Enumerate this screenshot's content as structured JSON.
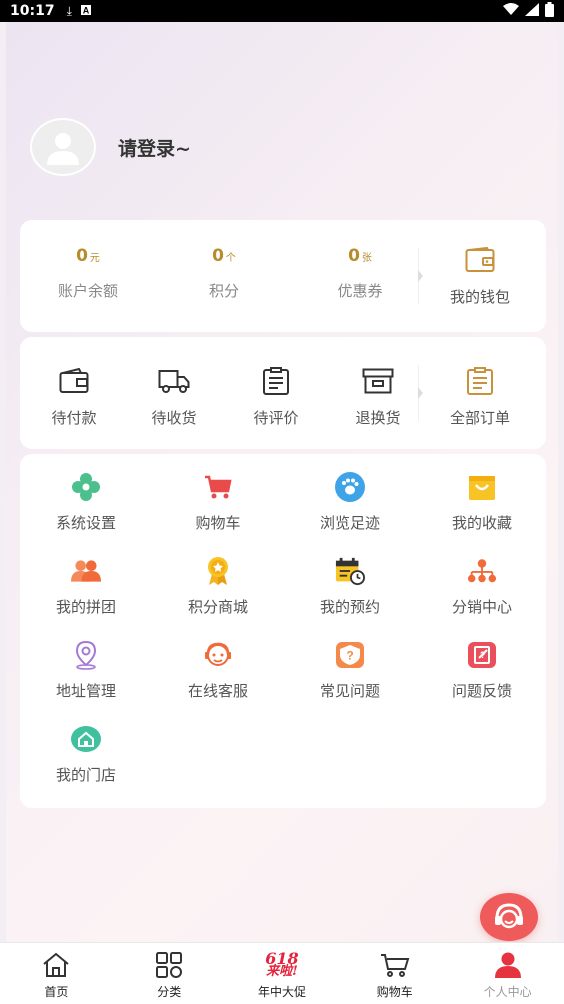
{
  "status_bar": {
    "time": "10:17"
  },
  "profile": {
    "login_text": "请登录~"
  },
  "stats": [
    {
      "value": "0",
      "unit": "元",
      "label": "账户余额"
    },
    {
      "value": "0",
      "unit": "个",
      "label": "积分"
    },
    {
      "value": "0",
      "unit": "张",
      "label": "优惠券"
    }
  ],
  "wallet": {
    "label": "我的钱包",
    "icon": "wallet-icon"
  },
  "orders": [
    {
      "label": "待付款",
      "icon": "wallet-outline-icon"
    },
    {
      "label": "待收货",
      "icon": "truck-icon"
    },
    {
      "label": "待评价",
      "icon": "clipboard-icon"
    },
    {
      "label": "退换货",
      "icon": "archive-box-icon"
    }
  ],
  "all_orders": {
    "label": "全部订单",
    "icon": "order-list-icon"
  },
  "menu": [
    {
      "label": "系统设置",
      "icon": "flower-settings-icon"
    },
    {
      "label": "购物车",
      "icon": "cart-icon"
    },
    {
      "label": "浏览足迹",
      "icon": "footprint-icon"
    },
    {
      "label": "我的收藏",
      "icon": "favorite-bag-icon"
    },
    {
      "label": "我的拼团",
      "icon": "group-icon"
    },
    {
      "label": "积分商城",
      "icon": "medal-icon"
    },
    {
      "label": "我的预约",
      "icon": "calendar-clock-icon"
    },
    {
      "label": "分销中心",
      "icon": "network-icon"
    },
    {
      "label": "地址管理",
      "icon": "location-pin-icon"
    },
    {
      "label": "在线客服",
      "icon": "customer-service-icon"
    },
    {
      "label": "常见问题",
      "icon": "question-icon"
    },
    {
      "label": "问题反馈",
      "icon": "feedback-icon"
    },
    {
      "label": "我的门店",
      "icon": "store-icon"
    }
  ],
  "tabbar": [
    {
      "label": "首页",
      "icon": "home-icon"
    },
    {
      "label": "分类",
      "icon": "category-icon"
    },
    {
      "label": "年中大促",
      "icon": "promo-618-icon",
      "promo_top": "618",
      "promo_bottom": "来啦!"
    },
    {
      "label": "购物车",
      "icon": "cart-icon"
    },
    {
      "label": "个人中心",
      "icon": "user-icon"
    }
  ],
  "colors": {
    "accent": "#ef5a5a",
    "gold": "#b68c2c",
    "active_tab": "#e5333f"
  }
}
